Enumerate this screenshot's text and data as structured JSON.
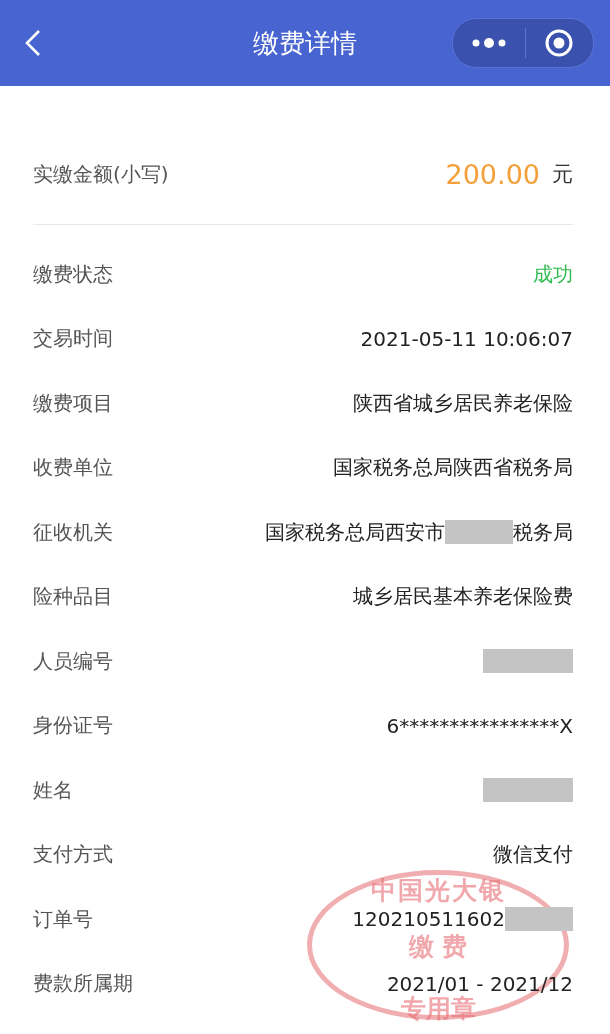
{
  "header": {
    "title": "缴费详情"
  },
  "amount": {
    "label": "实缴金额(小写)",
    "value": "200.00",
    "unit": "元"
  },
  "rows": [
    {
      "label": "缴费状态",
      "value": [
        {
          "kind": "status",
          "text": "成功",
          "color": "#2fbb4f"
        }
      ]
    },
    {
      "label": "交易时间",
      "value": [
        {
          "kind": "text",
          "text": "2021-05-11 10:06:07"
        }
      ]
    },
    {
      "label": "缴费项目",
      "value": [
        {
          "kind": "text",
          "text": "陕西省城乡居民养老保险"
        }
      ]
    },
    {
      "label": "收费单位",
      "value": [
        {
          "kind": "text",
          "text": "国家税务总局陕西省税务局"
        }
      ]
    },
    {
      "label": "征收机关",
      "value": [
        {
          "kind": "text",
          "text": "国家税务总局西安市"
        },
        {
          "kind": "redacted"
        },
        {
          "kind": "text",
          "text": "税务局"
        }
      ]
    },
    {
      "label": "险种品目",
      "value": [
        {
          "kind": "text",
          "text": "城乡居民基本养老保险费"
        }
      ]
    },
    {
      "label": "人员编号",
      "value": [
        {
          "kind": "redacted"
        }
      ]
    },
    {
      "label": "身份证号",
      "value": [
        {
          "kind": "text",
          "text": "6****************X"
        }
      ]
    },
    {
      "label": "姓名",
      "value": [
        {
          "kind": "redacted"
        }
      ]
    },
    {
      "label": "支付方式",
      "value": [
        {
          "kind": "text",
          "text": "微信支付"
        }
      ]
    },
    {
      "label": "订单号",
      "value": [
        {
          "kind": "text",
          "text": "120210511602"
        },
        {
          "kind": "redacted"
        }
      ]
    },
    {
      "label": "费款所属期",
      "value": [
        {
          "kind": "text",
          "text": "2021/01 - 2021/12"
        }
      ]
    }
  ],
  "stamp": {
    "lines": [
      "中国光大银",
      "缴 费",
      "专用章"
    ]
  }
}
